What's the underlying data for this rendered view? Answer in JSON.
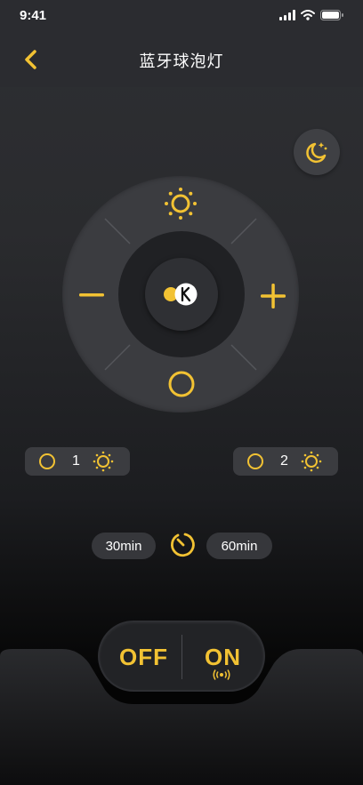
{
  "status_bar": {
    "time": "9:41"
  },
  "header": {
    "title": "蓝牙球泡灯"
  },
  "presets": [
    {
      "number": "1"
    },
    {
      "number": "2"
    }
  ],
  "timer": {
    "option_30": "30min",
    "option_60": "60min"
  },
  "power": {
    "off_label": "OFF",
    "on_label": "ON"
  },
  "colors": {
    "accent": "#F2C233",
    "background": "#2A2B2E",
    "panel": "#3B3C40"
  }
}
